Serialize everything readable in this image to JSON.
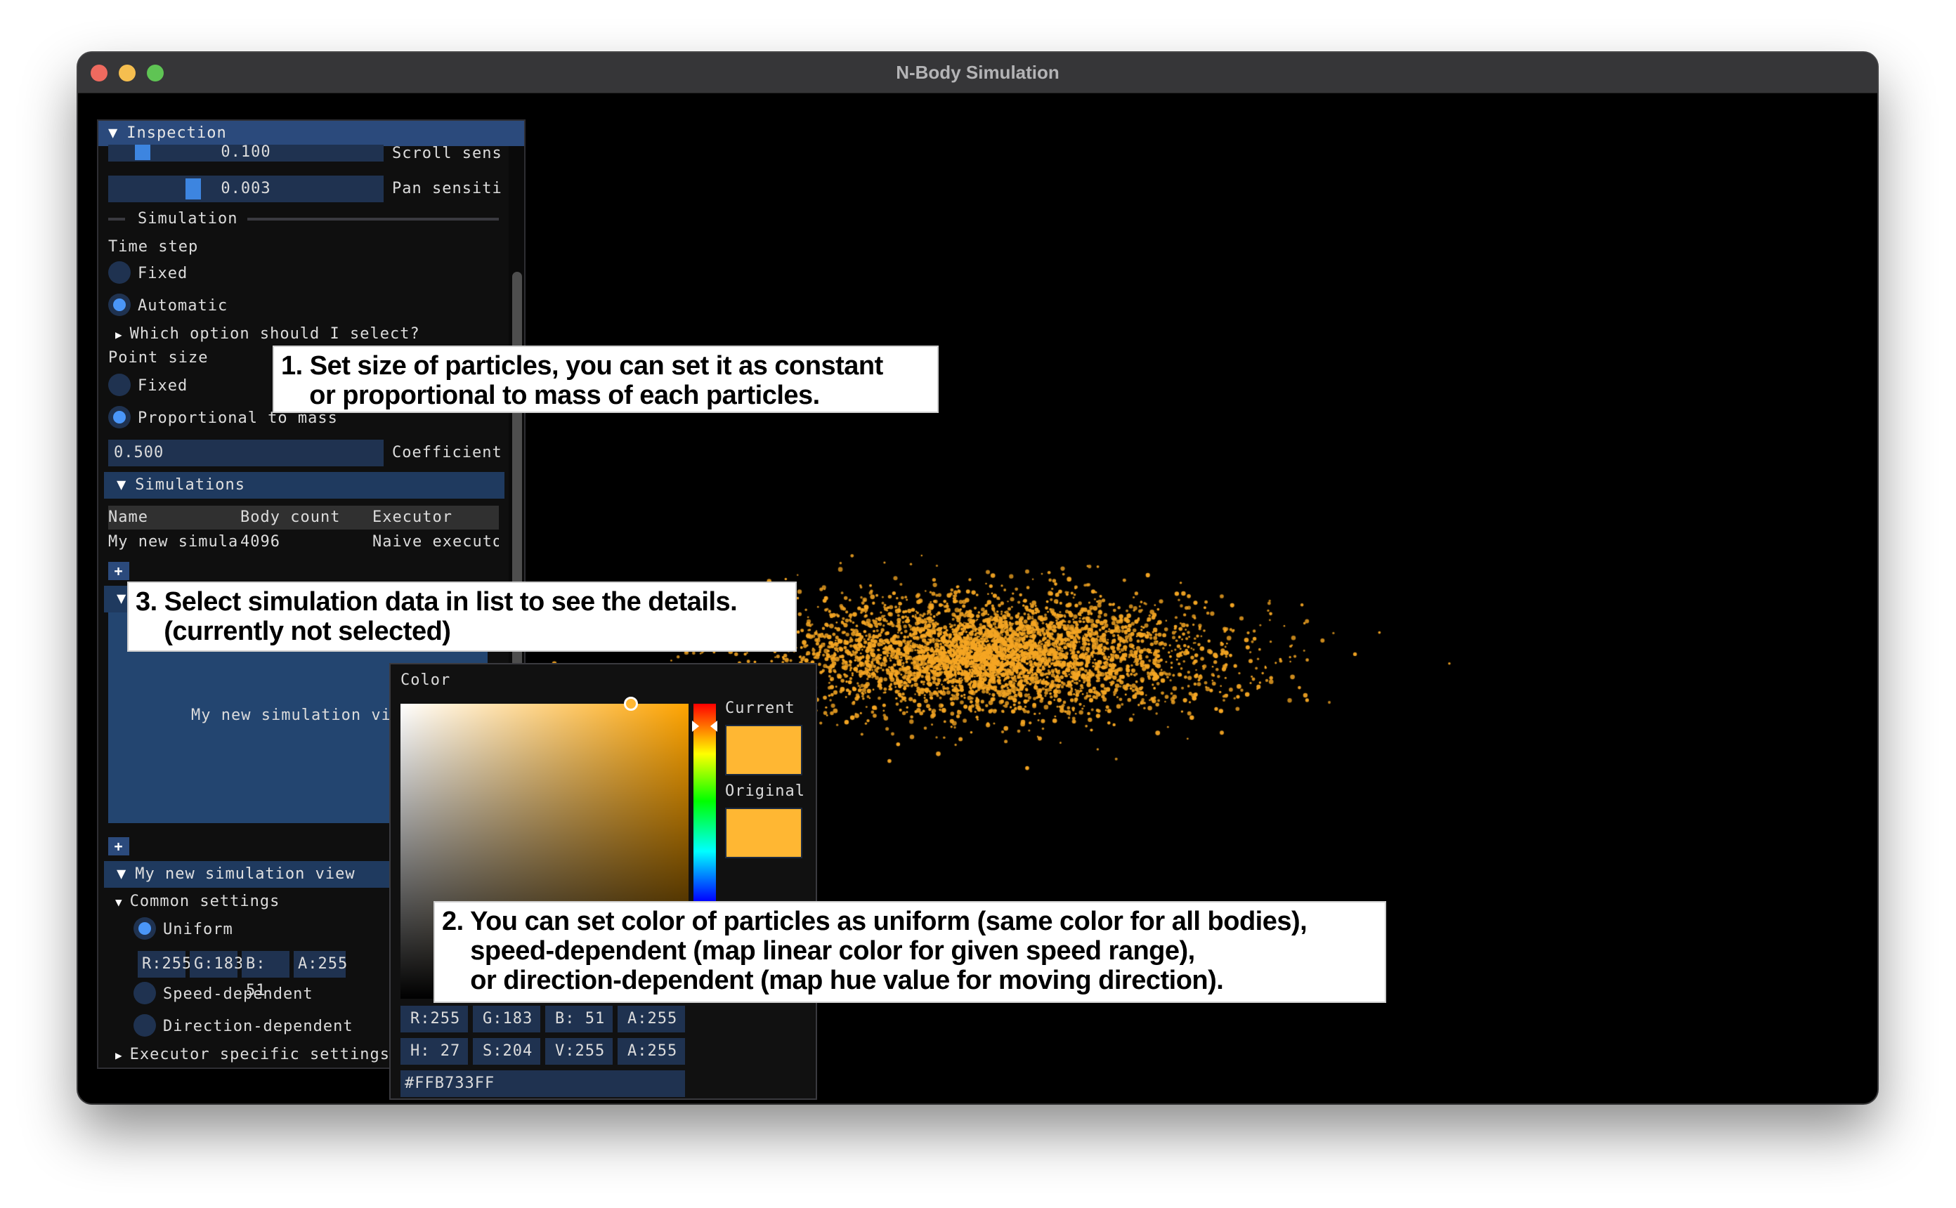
{
  "window": {
    "title": "N-Body Simulation",
    "controls": [
      "close",
      "minimize",
      "maximize"
    ]
  },
  "inspection": {
    "header": "Inspection",
    "sliders": [
      {
        "value": "0.100",
        "label": "Scroll sens",
        "fraction": 0.05
      },
      {
        "value": "0.003",
        "label": "Pan sensiti",
        "fraction": 0.2
      }
    ],
    "simulation_separator": "Simulation",
    "time_step": {
      "label": "Time step",
      "options": [
        {
          "label": "Fixed",
          "selected": false
        },
        {
          "label": "Automatic",
          "selected": true
        }
      ],
      "help_tree": "Which option should I select?"
    },
    "point_size": {
      "label": "Point size",
      "options": [
        {
          "label": "Fixed",
          "selected": false
        },
        {
          "label": "Proportional to mass",
          "selected": true
        }
      ],
      "coefficient_value": "0.500",
      "coefficient_label": "Coefficient"
    },
    "simulations": {
      "header": "Simulations",
      "columns": [
        "Name",
        "Body count",
        "Executor"
      ],
      "rows": [
        {
          "name": "My new simula",
          "body_count": "4096",
          "executor": "Naive executo"
        }
      ],
      "add_label": "+"
    },
    "views": {
      "placeholder_text": "My new simulation vi",
      "add_label": "+"
    },
    "view_settings": {
      "header": "My new simulation view",
      "common_header": "Common settings",
      "color_modes": [
        {
          "label": "Uniform",
          "selected": true
        },
        {
          "label": "Speed-dependent",
          "selected": false
        },
        {
          "label": "Direction-dependent",
          "selected": false
        }
      ],
      "uniform_rgba": [
        "R:255",
        "G:183",
        "B: 51",
        "A:255"
      ],
      "executor_header": "Executor specific settings"
    }
  },
  "color_picker": {
    "title": "Color",
    "current_label": "Current",
    "original_label": "Original",
    "current_color": "#FFB733",
    "original_color": "#FFB733",
    "hue_color": "#FFA400",
    "saturation_fraction": 0.8,
    "value_fraction": 1.0,
    "hue_fraction": 0.075,
    "rgba_fields": [
      "R:255",
      "G:183",
      "B: 51",
      "A:255"
    ],
    "hsva_fields": [
      "H: 27",
      "S:204",
      "V:255",
      "A:255"
    ],
    "hex_value": "#FFB733FF"
  },
  "particles": {
    "color": "#F5A623",
    "count_shown": 4096
  },
  "annotations": [
    {
      "id": 1,
      "text": "1. Set size of particles, you can set it as constant\n    or proportional to mass of each particles."
    },
    {
      "id": 2,
      "text": "2. You can set color of particles as uniform (same color for all bodies),\n    speed-dependent (map linear color for given speed range),\n    or direction-dependent (map hue value for moving direction)."
    },
    {
      "id": 3,
      "text": "3. Select simulation data in list to see the details.\n    (currently not selected)"
    }
  ]
}
